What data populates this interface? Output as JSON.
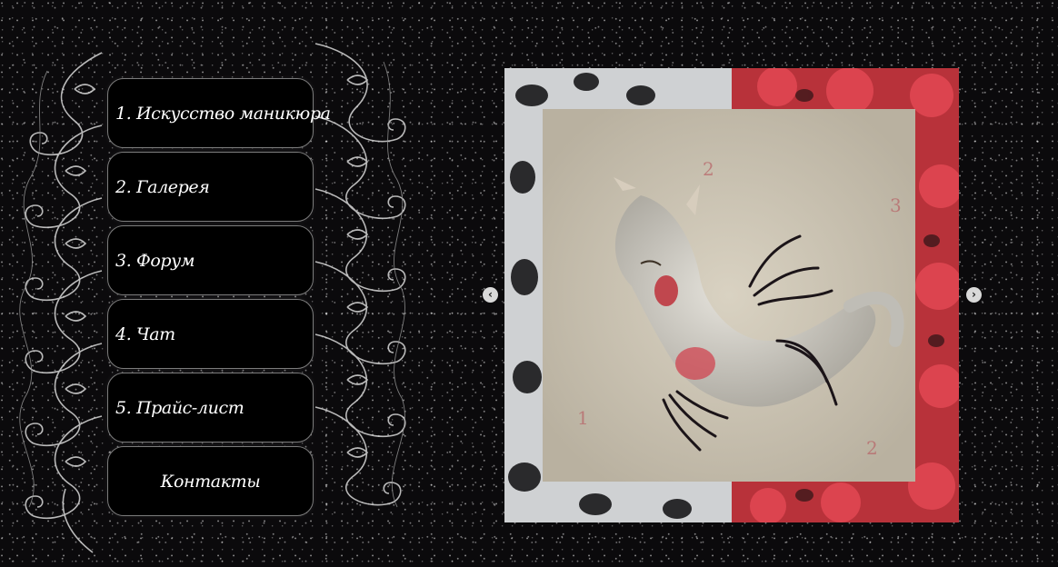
{
  "nav": {
    "items": [
      {
        "label": "1. Искусство маникюра"
      },
      {
        "label": "2. Галерея"
      },
      {
        "label": "3. Форум"
      },
      {
        "label": "4. Чат"
      },
      {
        "label": "5. Прайс-лист"
      },
      {
        "label": "Контакты"
      }
    ]
  },
  "slider": {
    "prev_icon": "chevron-left-icon",
    "next_icon": "chevron-right-icon",
    "prev_glyph": "‹",
    "next_glyph": "›"
  },
  "colors": {
    "background": "#0b0a0c",
    "button_bg": "#000000",
    "button_border": "#7c7c7c",
    "button_text": "#ffffff"
  }
}
